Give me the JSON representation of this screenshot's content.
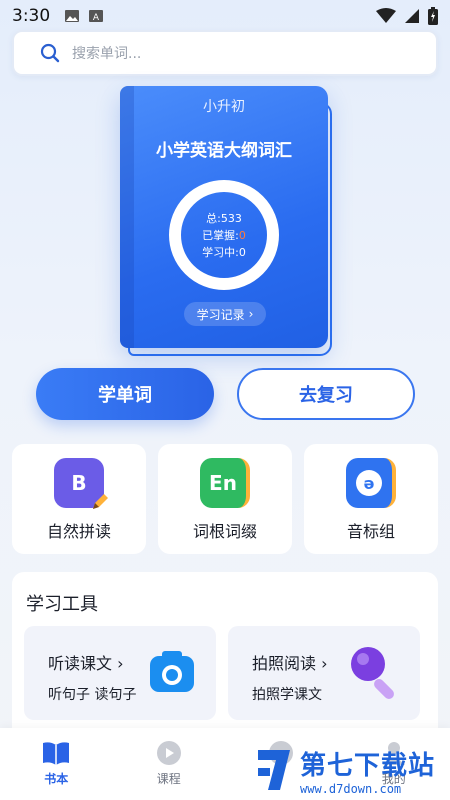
{
  "status_bar": {
    "time": "3:30"
  },
  "search": {
    "placeholder": "搜索单词..."
  },
  "book": {
    "grade": "小升初",
    "title": "小学英语大纲词汇",
    "total_label": "总:533",
    "mastered_label": "已掌握:",
    "mastered_value": "0",
    "learning_label": "学习中:0",
    "record_label": "学习记录",
    "record_arrow": "›"
  },
  "actions": {
    "learn": "学单词",
    "review": "去复习"
  },
  "features": [
    {
      "label": "自然拼读",
      "icon": "B",
      "icon_name": "phonics-book-icon",
      "color": "#6b5ce7"
    },
    {
      "label": "词根词缀",
      "icon": "En",
      "icon_name": "word-root-book-icon",
      "color": "#2fba61"
    },
    {
      "label": "音标组",
      "icon": "ə",
      "icon_name": "phonetic-book-icon",
      "color": "#2f73f0"
    }
  ],
  "tools": {
    "title": "学习工具",
    "cards": [
      {
        "title": "听读课文",
        "arrow": "›",
        "subtitle": "听句子 读句子",
        "icon_name": "camera-icon"
      },
      {
        "title": "拍照阅读",
        "arrow": "›",
        "subtitle": "拍照学课文",
        "icon_name": "magnifier-icon"
      }
    ]
  },
  "tabbar": [
    {
      "label": "书本",
      "active": true
    },
    {
      "label": "课程",
      "active": false
    },
    {
      "label": "",
      "active": false
    },
    {
      "label": "我的",
      "active": false
    }
  ],
  "watermark": {
    "text": "第七下载站",
    "url": "www.d7down.com"
  },
  "colors": {
    "accent": "#2a63e6",
    "highlight": "#ff7a3d"
  }
}
